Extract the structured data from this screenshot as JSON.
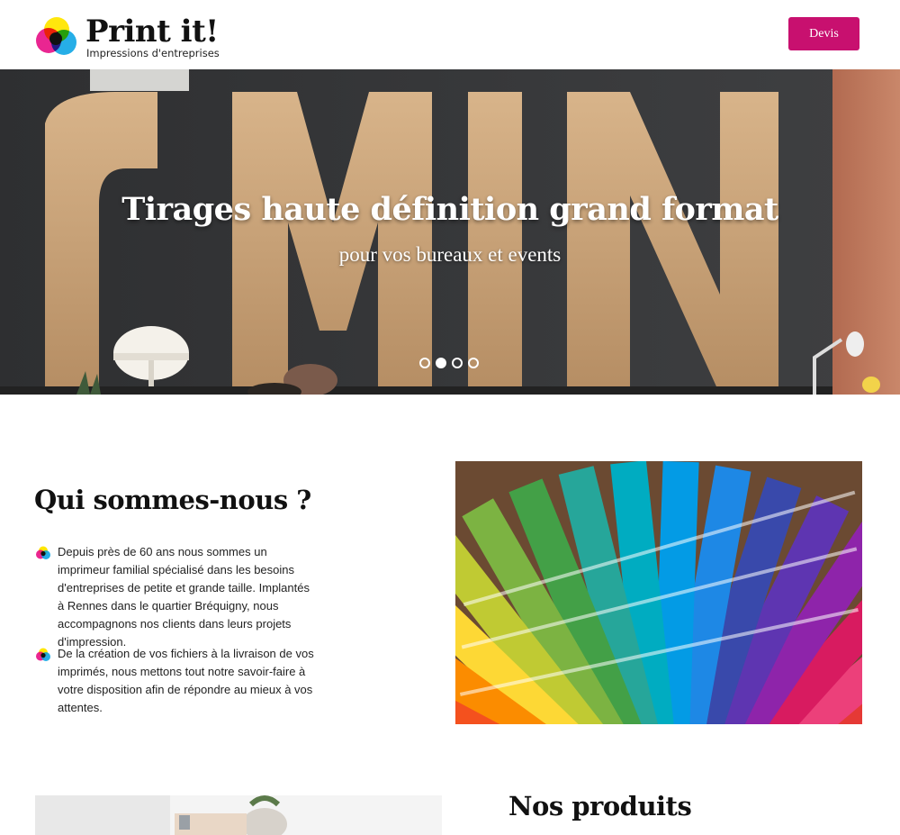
{
  "header": {
    "logo_title": "Print it!",
    "logo_subtitle": "Impressions d'entreprises",
    "cta_label": "Devis",
    "brand_color": "#c8106f"
  },
  "hero": {
    "title": "Tirages haute définition grand format",
    "subtitle": "pour vos bureaux et events",
    "slides_count": 4,
    "active_slide": 2,
    "background_letters": "CMYK"
  },
  "about": {
    "title": "Qui sommes-nous ?",
    "paragraphs": [
      "Depuis près de 60 ans nous sommes un imprimeur familial spécialisé dans les besoins d'entreprises de petite et grande taille. Implantés à Rennes dans le quartier Bréquigny, nous accompagnons nos clients dans leurs projets d'impression.",
      "De la création de vos fichiers à la livraison de vos imprimés, nous mettons tout notre savoir-faire à votre disposition afin de répondre au mieux à vos attentes."
    ],
    "image": "pantone-color-swatches"
  },
  "products": {
    "title": "Nos produits",
    "image": "office-desk-photo"
  },
  "icons": {
    "logo": "cmyk-circles-icon",
    "bullet": "cmyk-bullet-icon"
  }
}
